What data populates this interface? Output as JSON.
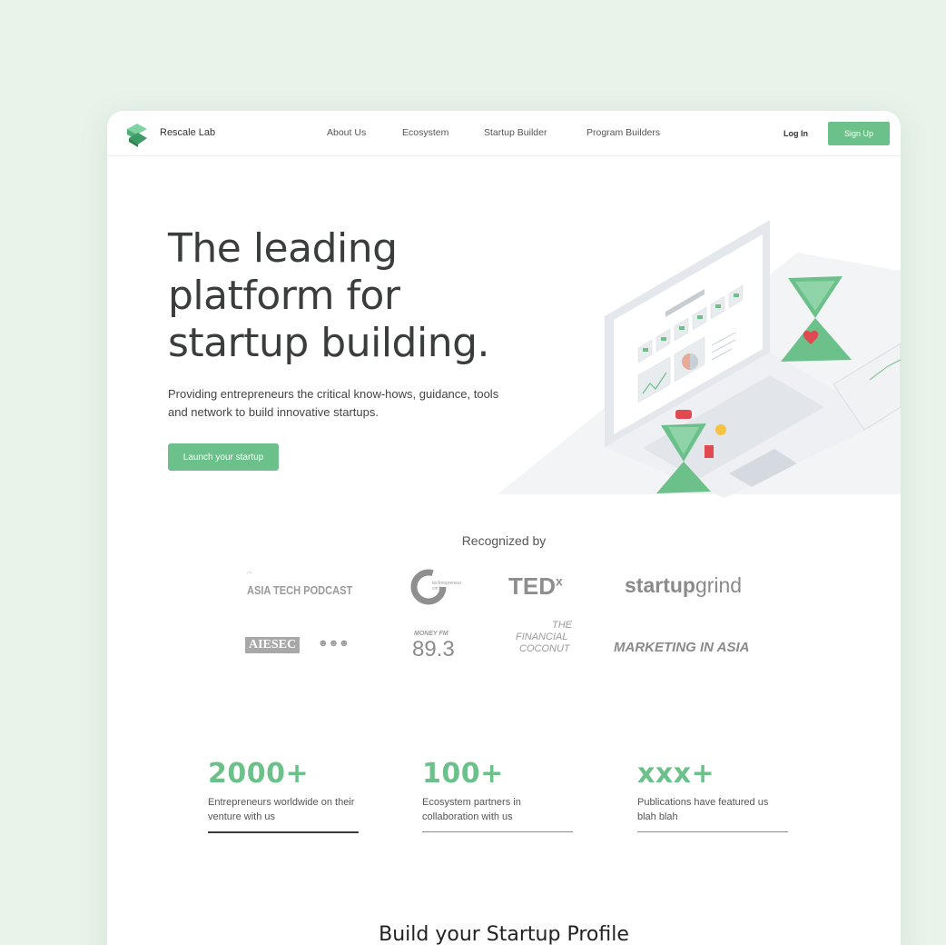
{
  "nav": {
    "brand": "Rescale Lab",
    "links": [
      "About Us",
      "Ecosystem",
      "Startup Builder",
      "Program Builders"
    ],
    "login": "Log In",
    "signup": "Sign Up"
  },
  "hero": {
    "title_line1": "The leading",
    "title_line2": "platform for",
    "title_line3": "startup building.",
    "subtitle": "Providing entrepreneurs the critical know-hows, guidance, tools and network to build innovative startups.",
    "cta": "Launch your startup"
  },
  "recognized": {
    "title": "Recognized by",
    "logos": {
      "asia_tech_podcast": "ASIA TECH PODCAST",
      "technopreneur": "technopreneur circle",
      "tedx": "TED",
      "tedx_sup": "x",
      "startupgrind_a": "startup",
      "startupgrind_b": "grind",
      "aiesec": "AIESEC",
      "moneyfm_top": "MONEY FM",
      "moneyfm_num": "89.3",
      "financial_1": "THE",
      "financial_2": "FINANCIAL",
      "financial_3": "COCONUT",
      "marketing_asia": "MARKETING IN ASIA"
    }
  },
  "stats": [
    {
      "value": "2000+",
      "desc": "Entrepreneurs worldwide on their venture with us"
    },
    {
      "value": "100+",
      "desc": "Ecosystem partners in collaboration with us"
    },
    {
      "value": "xxx+",
      "desc": "Publications have featured us blah blah"
    }
  ],
  "next_section": {
    "title": "Build your Startup Profile"
  },
  "colors": {
    "accent": "#6cc08a",
    "background": "#e8f3ea",
    "card": "#ffffff"
  }
}
